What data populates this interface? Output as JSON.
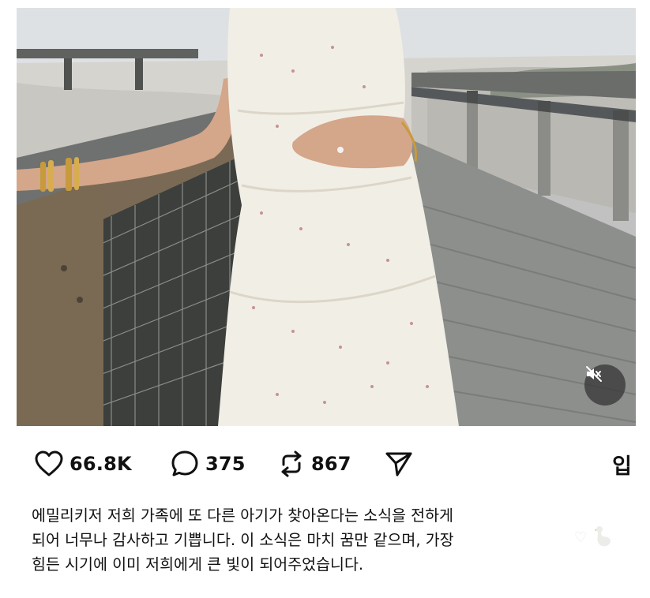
{
  "post": {
    "media": {
      "type": "video",
      "description_icon": "muted-speaker-icon"
    },
    "actions": {
      "likes": "66.8K",
      "comments": "375",
      "reposts": "867"
    },
    "right_truncated_text": "입",
    "caption_lines": [
      "에밀리키저 저희 가족에 또 다른 아기가 찾아온다는 소식을 전하게",
      "되어 너무나 감사하고 기쁩니다. 이 소식은 마치 꿈만 같으며, 가장",
      "힘든 시기에 이미 저희에게 큰 빛이 되어주었습니다."
    ]
  },
  "colors": {
    "text": "#111111",
    "mute_button_bg": "#3c3c3c",
    "boardwalk": "#8d8f8c",
    "dress": "#f1eee6"
  }
}
